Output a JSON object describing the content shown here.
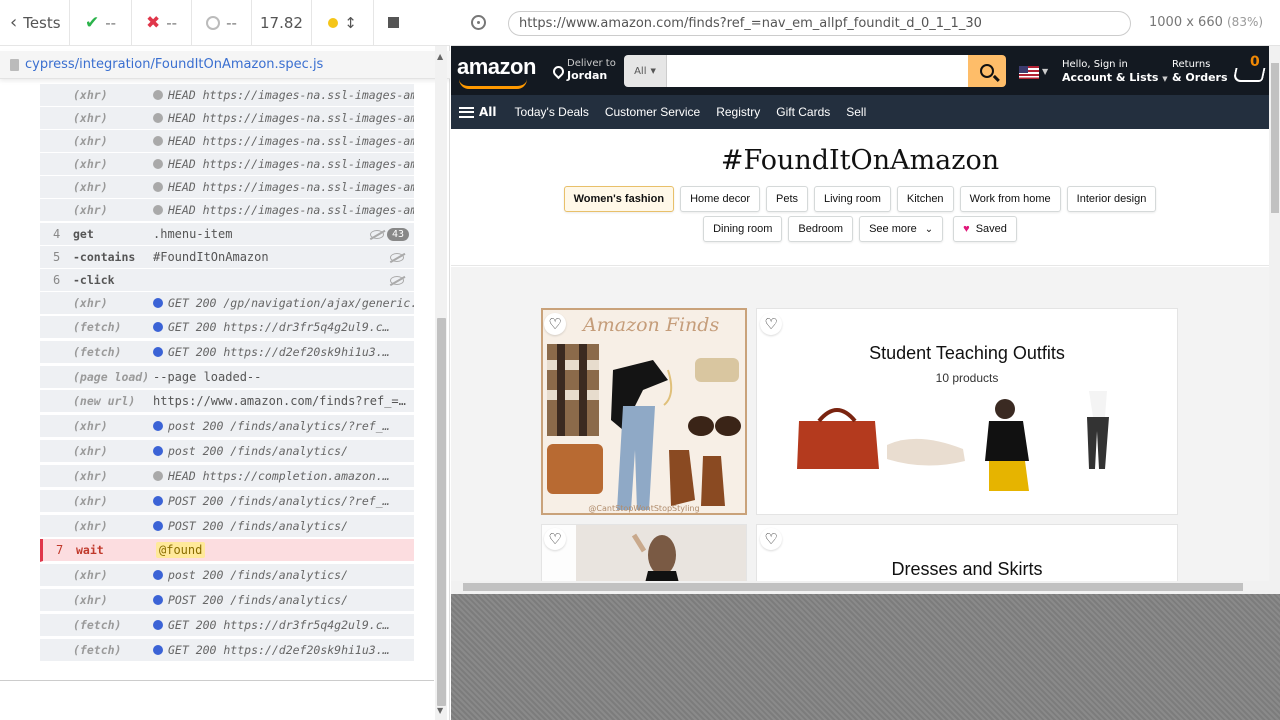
{
  "reporter": {
    "tests_label": "Tests",
    "passed": "--",
    "failed": "--",
    "pending": "--",
    "duration": "17.82",
    "spec_path": "cypress/integration/FoundItOnAmazon.spec.js"
  },
  "commands": [
    {
      "num": "",
      "name": "(xhr)",
      "bullet": "gray",
      "msg": "HEAD https://images-na.ssl-images-ama…"
    },
    {
      "num": "",
      "name": "(xhr)",
      "bullet": "gray",
      "msg": "HEAD https://images-na.ssl-images-ama…"
    },
    {
      "num": "",
      "name": "(xhr)",
      "bullet": "gray",
      "msg": "HEAD https://images-na.ssl-images-ama…"
    },
    {
      "num": "",
      "name": "(xhr)",
      "bullet": "gray",
      "msg": "HEAD https://images-na.ssl-images-ama…"
    },
    {
      "num": "",
      "name": "(xhr)",
      "bullet": "gray",
      "msg": "HEAD https://images-na.ssl-images-ama…"
    },
    {
      "num": "",
      "name": "(xhr)",
      "bullet": "gray",
      "msg": "HEAD https://images-na.ssl-images-ama…"
    },
    {
      "num": "4",
      "name": "get",
      "bullet": "",
      "msg": ".hmenu-item",
      "count": "43"
    },
    {
      "num": "5",
      "name": "-contains",
      "bullet": "",
      "msg": "#FoundItOnAmazon"
    },
    {
      "num": "6",
      "name": "-click",
      "bullet": "",
      "msg": ""
    },
    {
      "num": "",
      "name": "(xhr)",
      "bullet": "blue",
      "msg": "GET 200 /gp/navigation/ajax/generic.h…"
    },
    {
      "num": "",
      "name": "(fetch)",
      "bullet": "blue",
      "msg": "GET 200 https://dr3fr5q4g2ul9.c…"
    },
    {
      "num": "",
      "name": "(fetch)",
      "bullet": "blue",
      "msg": "GET 200 https://d2ef20sk9hi1u3.…"
    },
    {
      "num": "",
      "name": "(page load)",
      "bullet": "",
      "msg": "--page loaded--"
    },
    {
      "num": "",
      "name": "(new url)",
      "bullet": "",
      "msg": "https://www.amazon.com/finds?ref_=…"
    },
    {
      "num": "",
      "name": "(xhr)",
      "bullet": "blue",
      "msg": "post 200 /finds/analytics/?ref_…"
    },
    {
      "num": "",
      "name": "(xhr)",
      "bullet": "blue",
      "msg": "post 200 /finds/analytics/"
    },
    {
      "num": "",
      "name": "(xhr)",
      "bullet": "gray",
      "msg": "HEAD https://completion.amazon.…"
    },
    {
      "num": "",
      "name": "(xhr)",
      "bullet": "blue",
      "msg": "POST 200 /finds/analytics/?ref_…"
    },
    {
      "num": "",
      "name": "(xhr)",
      "bullet": "blue",
      "msg": "POST 200 /finds/analytics/"
    },
    {
      "num": "7",
      "name": "wait",
      "bullet": "",
      "msg": "@found",
      "alias": true
    },
    {
      "num": "",
      "name": "(xhr)",
      "bullet": "blue",
      "msg": "post 200 /finds/analytics/"
    },
    {
      "num": "",
      "name": "(xhr)",
      "bullet": "blue",
      "msg": "POST 200 /finds/analytics/"
    },
    {
      "num": "",
      "name": "(fetch)",
      "bullet": "blue",
      "msg": "GET 200 https://dr3fr5q4g2ul9.c…"
    },
    {
      "num": "",
      "name": "(fetch)",
      "bullet": "blue",
      "msg": "GET 200 https://d2ef20sk9hi1u3.…"
    }
  ],
  "aut": {
    "url": "https://www.amazon.com/finds?ref_=nav_em_allpf_foundit_d_0_1_1_30",
    "viewport": "1000 x 660",
    "scale": "(83%)"
  },
  "amazon": {
    "logo": "amazon",
    "deliver_label": "Deliver to",
    "deliver_name": "Jordan",
    "search_category": "All",
    "search_placeholder": "",
    "account_line1": "Hello, Sign in",
    "account_line2": "Account & Lists",
    "returns_line1": "Returns",
    "returns_line2": "& Orders",
    "cart_count": "0",
    "nav_all": "All",
    "nav_links": [
      "Today's Deals",
      "Customer Service",
      "Registry",
      "Gift Cards",
      "Sell"
    ]
  },
  "finds": {
    "title": "#FoundItOnAmazon",
    "row1": [
      "Women's fashion",
      "Home decor",
      "Pets",
      "Living room",
      "Kitchen",
      "Work from home",
      "Interior design"
    ],
    "row2": [
      "Dining room",
      "Bedroom",
      "See more"
    ],
    "saved": "Saved",
    "collage_title": "Amazon Finds",
    "collage_credit": "@CantStopWontStopStyling",
    "card1_title": "Student Teaching Outfits",
    "card1_sub": "10 products",
    "card2_title": "Dresses and Skirts"
  },
  "colors": {
    "amazon_dark": "#131921",
    "amazon_nav": "#232f3e",
    "search_button": "#febd69",
    "pass": "#2bb34b",
    "fail": "#e0364a"
  }
}
